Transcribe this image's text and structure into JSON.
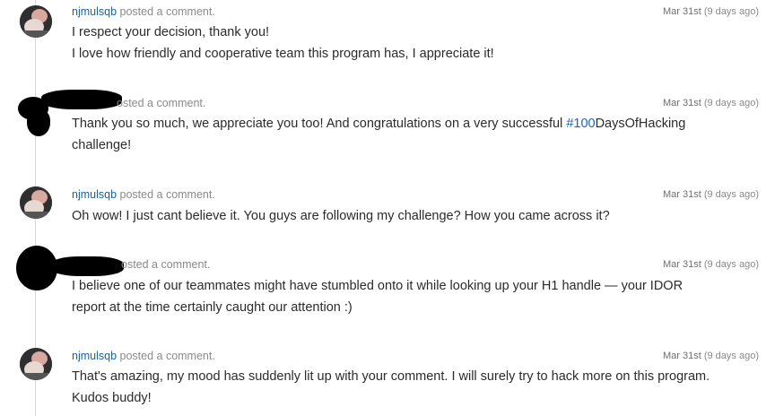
{
  "comments": [
    {
      "username": "njmulsqb",
      "action": "posted a comment.",
      "date": "Mar 31st",
      "ago": "(9 days ago)",
      "lines": [
        "I respect your decision, thank you!",
        "I love how friendly and cooperative team this program has, I appreciate it!"
      ],
      "avatar": "user-avatar"
    },
    {
      "username": "",
      "action": "posted a comment.",
      "action_visible": "osted a comment.",
      "date": "Mar 31st",
      "ago": "(9 days ago)",
      "text_before": "Thank you so much, we appreciate you too! And congratulations on a very successful ",
      "hashtag": "#100",
      "text_after": "DaysOfHacking",
      "line2": "challenge!",
      "avatar": "redacted-avatar"
    },
    {
      "username": "njmulsqb",
      "action": "posted a comment.",
      "date": "Mar 31st",
      "ago": "(9 days ago)",
      "lines": [
        "Oh wow! I just cant believe it. You guys are following my challenge? How you came across it?"
      ],
      "avatar": "user-avatar"
    },
    {
      "username": "",
      "action": "posted a comment.",
      "action_visible": "osted a comment.",
      "date": "Mar 31st",
      "ago": "(9 days ago)",
      "lines": [
        "I believe one of our teammates might have stumbled onto it while looking up your H1 handle — your IDOR",
        "report at the time certainly caught our attention :)"
      ],
      "avatar": "redacted-avatar"
    },
    {
      "username": "njmulsqb",
      "action": "posted a comment.",
      "date": "Mar 31st",
      "ago": "(9 days ago)",
      "lines": [
        "That's amazing, my mood has suddenly lit up with your comment. I will surely try to hack more on this program.",
        "Kudos buddy!"
      ],
      "avatar": "user-avatar"
    }
  ],
  "colors": {
    "username": "#1f5f9a",
    "hashtag": "#1f63b8",
    "meta": "#8a8a8a",
    "timeline": "#d8d8d8"
  }
}
